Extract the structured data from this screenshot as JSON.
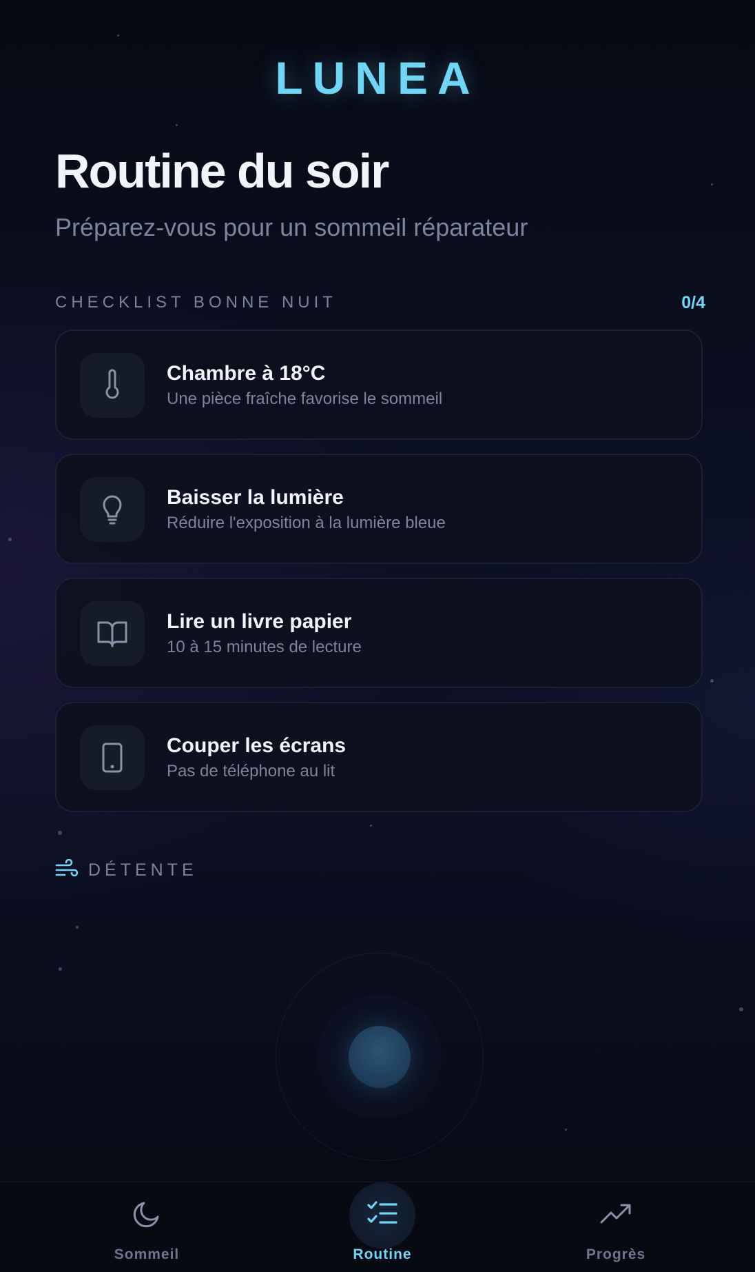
{
  "app": {
    "logo": "LUNEA"
  },
  "header": {
    "title": "Routine du soir",
    "subtitle": "Préparez-vous pour un sommeil réparateur"
  },
  "checklist": {
    "label": "CHECKLIST BONNE NUIT",
    "count": "0/4",
    "items": [
      {
        "icon": "thermometer-icon",
        "title": "Chambre à 18°C",
        "description": "Une pièce fraîche favorise le sommeil"
      },
      {
        "icon": "lightbulb-icon",
        "title": "Baisser la lumière",
        "description": "Réduire l'exposition à la lumière bleue"
      },
      {
        "icon": "book-icon",
        "title": "Lire un livre papier",
        "description": "10 à 15 minutes de lecture"
      },
      {
        "icon": "phone-icon",
        "title": "Couper les écrans",
        "description": "Pas de téléphone au lit"
      }
    ]
  },
  "relaxation": {
    "label": "DÉTENTE",
    "icon": "wind-icon"
  },
  "nav": {
    "items": [
      {
        "label": "Sommeil",
        "icon": "moon-icon",
        "active": false
      },
      {
        "label": "Routine",
        "icon": "checklist-icon",
        "active": true
      },
      {
        "label": "Progrès",
        "icon": "trending-up-icon",
        "active": false
      }
    ]
  },
  "colors": {
    "accent": "#6fd6f5",
    "muted_text": "#7c849e",
    "card_border": "#1a2133",
    "background": "#0b0f22"
  }
}
